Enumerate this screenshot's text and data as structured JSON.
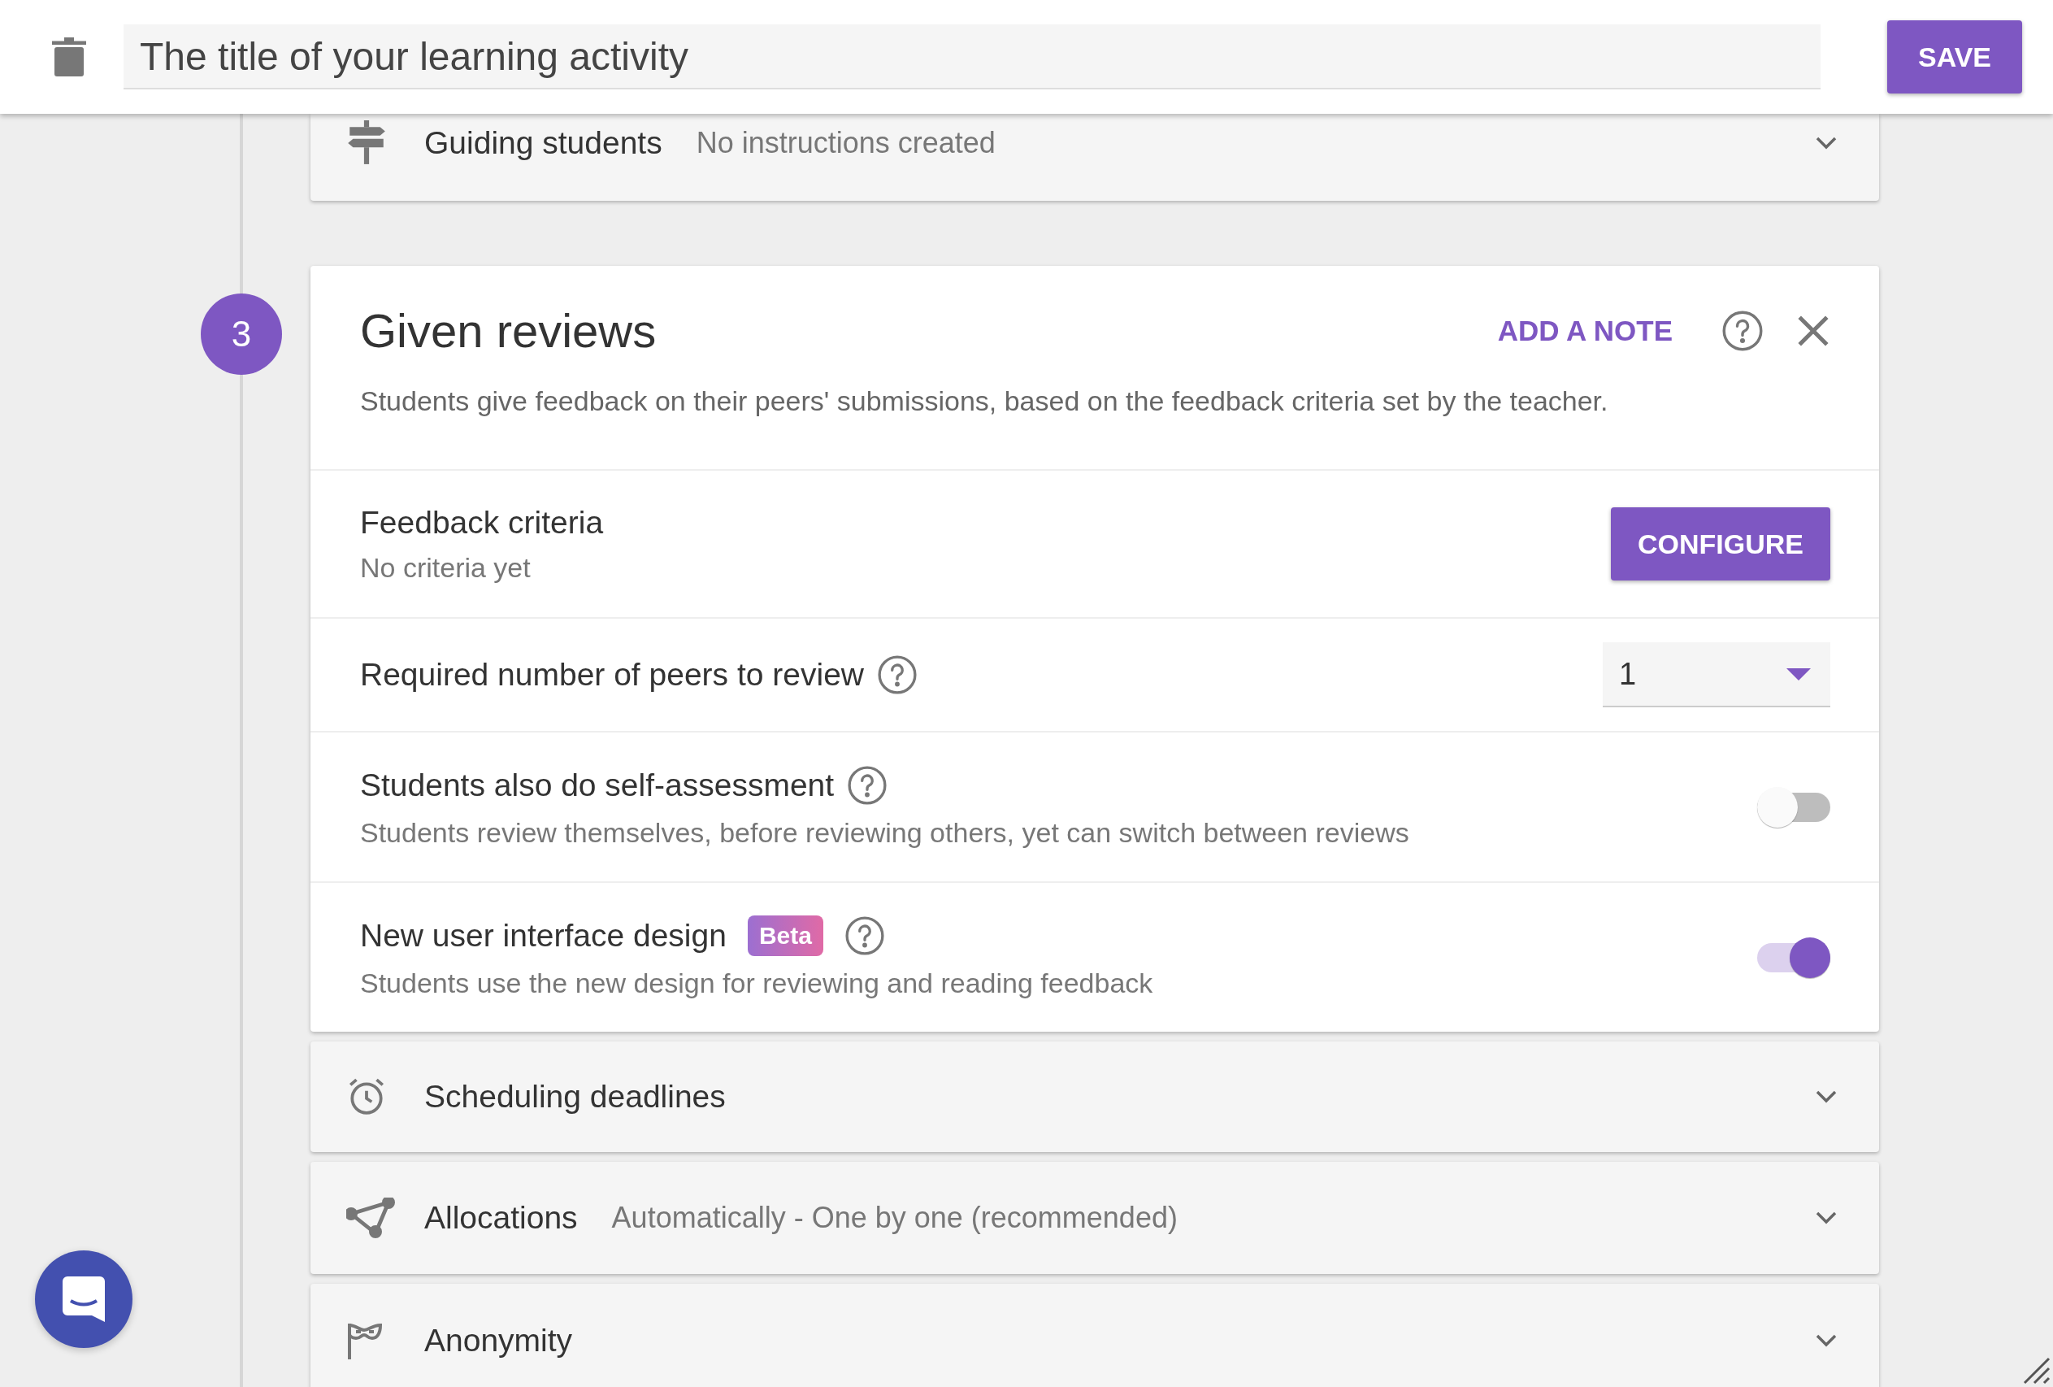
{
  "header": {
    "title_field": {
      "value": "The title of your learning activity"
    },
    "save_button": "SAVE"
  },
  "sections_before": [
    {
      "title": "Guiding students",
      "subtitle": "No instructions created"
    }
  ],
  "active_section": {
    "step": "3",
    "title": "Given reviews",
    "add_note": "ADD A NOTE",
    "description": "Students give feedback on their peers' submissions, based on the feedback criteria set by the teacher.",
    "settings": [
      {
        "kind": "configure",
        "label": "Feedback criteria",
        "help": false,
        "hint": "No criteria yet",
        "button": "CONFIGURE"
      },
      {
        "kind": "dropdown",
        "label": "Required number of peers to review",
        "help": true,
        "value": "1"
      },
      {
        "kind": "toggle",
        "label": "Students also do self-assessment",
        "help": true,
        "hint": "Students review themselves, before reviewing others, yet can switch between reviews",
        "on": false
      },
      {
        "kind": "toggle",
        "label": "New user interface design",
        "badge": "Beta",
        "help": true,
        "hint": "Students use the new design for reviewing and reading feedback",
        "on": true
      }
    ]
  },
  "sections_after": [
    {
      "title": "Scheduling deadlines"
    },
    {
      "title": "Allocations",
      "subtitle": "Automatically - One by one (recommended)"
    },
    {
      "title": "Anonymity"
    }
  ]
}
